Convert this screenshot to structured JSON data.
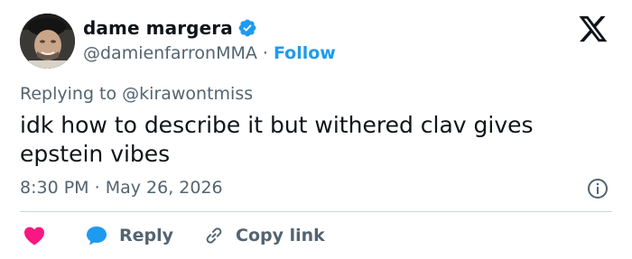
{
  "author": {
    "display_name": "dame margera",
    "handle": "@damienfarronMMA",
    "separator": "·",
    "follow_label": "Follow"
  },
  "reply_context": "Replying to @kirawontmiss",
  "tweet": {
    "text": "idk how to describe it but withered clav gives epstein vibes",
    "time": "8:30 PM",
    "separator": "·",
    "date": "May 26, 2026"
  },
  "actions": {
    "reply_label": "Reply",
    "copy_label": "Copy link"
  },
  "icons": {
    "logo": "x-logo-icon",
    "verified": "verified-badge-icon",
    "info": "info-icon",
    "like": "heart-icon",
    "reply": "chat-bubble-icon",
    "copy": "link-icon"
  },
  "colors": {
    "accent": "#1d9bf0",
    "like": "#f91880",
    "text": "#0f1419",
    "secondary": "#536471",
    "divider": "#cfd9de"
  }
}
